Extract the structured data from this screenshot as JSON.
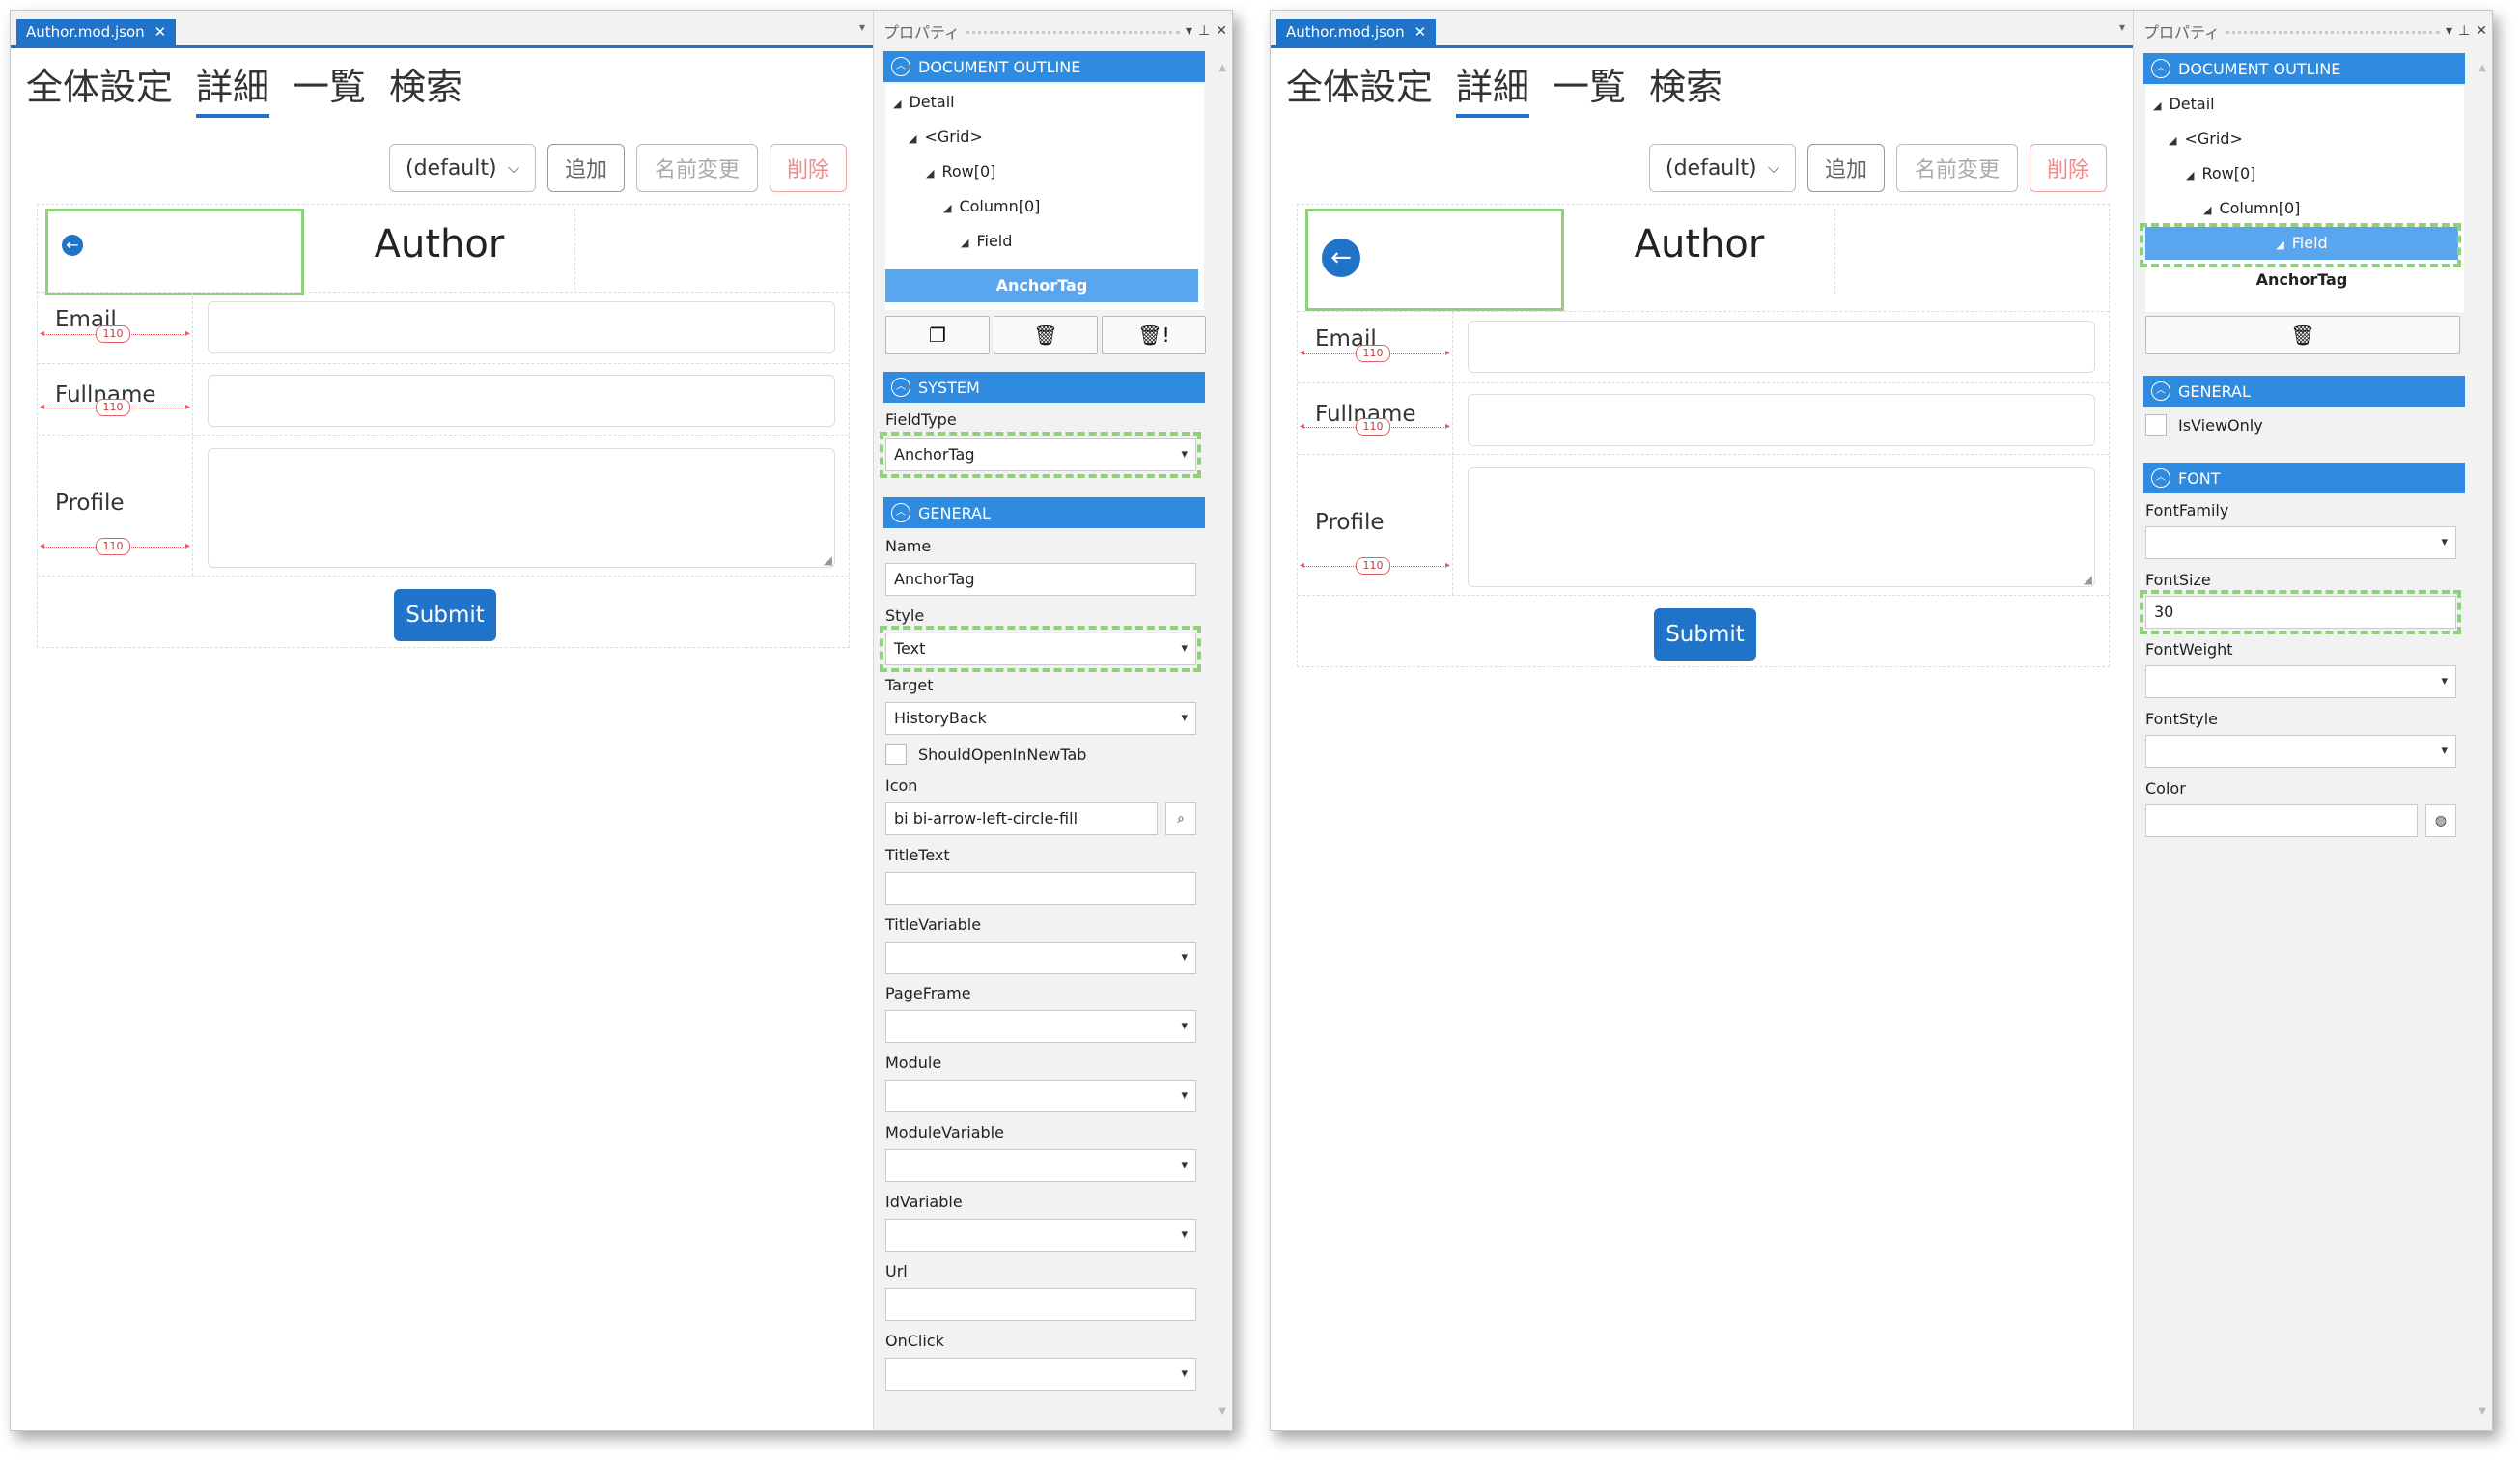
{
  "left": {
    "file_tab": "Author.mod.json",
    "nav_tabs": [
      "全体設定",
      "詳細",
      "一覧",
      "検索"
    ],
    "toolbar": {
      "select_value": "(default)",
      "add": "追加",
      "rename": "名前変更",
      "delete": "削除"
    },
    "form": {
      "title": "Author",
      "email_label": "Email",
      "fullname_label": "Fullname",
      "profile_label": "Profile",
      "measure_value": "110",
      "submit": "Submit"
    },
    "props": {
      "title": "プロパティ",
      "outline_header": "DOCUMENT OUTLINE",
      "tree": [
        "Detail",
        "<Grid>",
        "Row[0]",
        "Column[0]",
        "Field"
      ],
      "selected": "AnchorTag",
      "system_header": "SYSTEM",
      "fieldtype_label": "FieldType",
      "fieldtype_value": "AnchorTag",
      "general_header": "GENERAL",
      "name_label": "Name",
      "name_value": "AnchorTag",
      "style_label": "Style",
      "style_value": "Text",
      "target_label": "Target",
      "target_value": "HistoryBack",
      "newtab_label": "ShouldOpenInNewTab",
      "icon_label": "Icon",
      "icon_value": "bi bi-arrow-left-circle-fill",
      "titletext_label": "TitleText",
      "titlevariable_label": "TitleVariable",
      "pageframe_label": "PageFrame",
      "module_label": "Module",
      "modulevariable_label": "ModuleVariable",
      "idvariable_label": "IdVariable",
      "url_label": "Url",
      "onclick_label": "OnClick"
    }
  },
  "right": {
    "file_tab": "Author.mod.json",
    "nav_tabs": [
      "全体設定",
      "詳細",
      "一覧",
      "検索"
    ],
    "toolbar": {
      "select_value": "(default)",
      "add": "追加",
      "rename": "名前変更",
      "delete": "削除"
    },
    "form": {
      "title": "Author",
      "email_label": "Email",
      "fullname_label": "Fullname",
      "profile_label": "Profile",
      "measure_value": "110",
      "submit": "Submit"
    },
    "props": {
      "title": "プロパティ",
      "outline_header": "DOCUMENT OUTLINE",
      "tree": [
        "Detail",
        "<Grid>",
        "Row[0]",
        "Column[0]",
        "Field"
      ],
      "selected": "AnchorTag",
      "general_header": "GENERAL",
      "isviewonly_label": "IsViewOnly",
      "font_header": "FONT",
      "fontfamily_label": "FontFamily",
      "fontsize_label": "FontSize",
      "fontsize_value": "30",
      "fontweight_label": "FontWeight",
      "fontstyle_label": "FontStyle",
      "color_label": "Color"
    }
  },
  "colors": {
    "accent": "#1f73c8",
    "section": "#2f8be0",
    "highlight": "#8fd07a",
    "danger": "#f08a8a"
  }
}
